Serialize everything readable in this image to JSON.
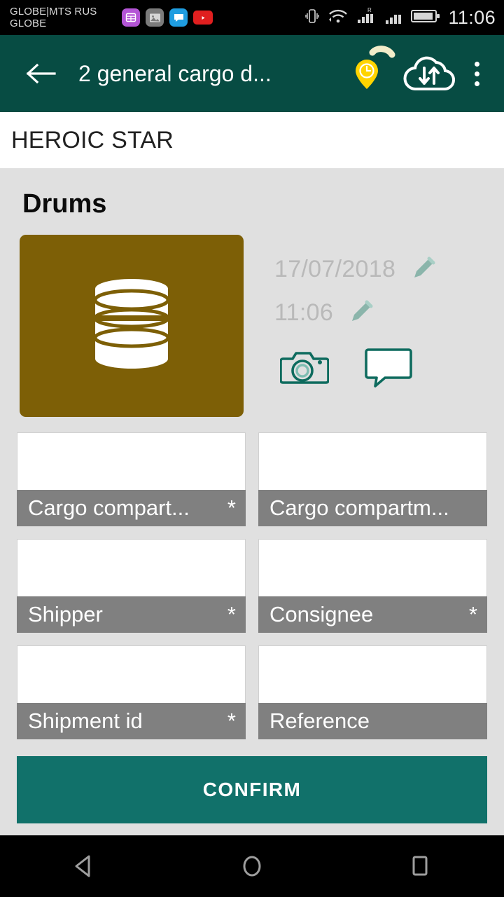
{
  "status_bar": {
    "carrier": "GLOBE|MTS RUS GLOBE",
    "clock": "11:06",
    "app_icons": [
      "calendar-icon",
      "gallery-icon",
      "messages-icon",
      "youtube-icon"
    ],
    "system_icons": [
      "vibrate-icon",
      "wifi-icon",
      "signal-roaming-icon",
      "signal-icon",
      "battery-icon"
    ]
  },
  "toolbar": {
    "back_icon": "back-arrow-icon",
    "title": "2 general cargo d...",
    "location_icon": "location-clock-pin-icon",
    "sync_icon": "cloud-sync-icon",
    "overflow_icon": "overflow-menu-icon"
  },
  "vessel": {
    "name": "HEROIC STAR"
  },
  "cargo": {
    "title": "Drums",
    "tile_icon": "drum-icon",
    "tile_color": "#7d5f06",
    "date": "17/07/2018",
    "time": "11:06",
    "edit_icon": "pencil-icon",
    "camera_icon": "camera-icon",
    "comment_icon": "comment-icon"
  },
  "form": {
    "fields": [
      {
        "label": "Cargo compart...",
        "required": "*",
        "value": "",
        "name": "cargo-compartment-from"
      },
      {
        "label": "Cargo compartm...",
        "required": "",
        "value": "",
        "name": "cargo-compartment-to"
      },
      {
        "label": "Shipper",
        "required": "*",
        "value": "",
        "name": "shipper"
      },
      {
        "label": "Consignee",
        "required": "*",
        "value": "",
        "name": "consignee"
      },
      {
        "label": "Shipment id",
        "required": "*",
        "value": "",
        "name": "shipment-id"
      },
      {
        "label": "Reference",
        "required": "",
        "value": "",
        "name": "reference"
      }
    ],
    "confirm_label": "CONFIRM",
    "confirm_color": "#11716a"
  },
  "nav_bar": {
    "back": "nav-back-icon",
    "home": "nav-home-icon",
    "recents": "nav-recents-icon"
  }
}
